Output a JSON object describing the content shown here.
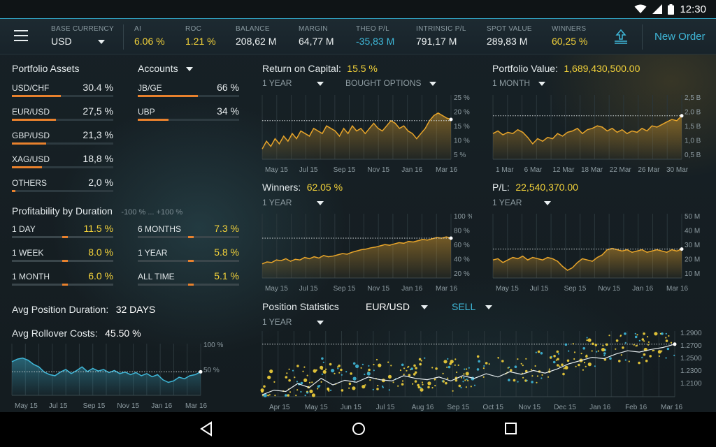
{
  "status": {
    "time": "12:30"
  },
  "header": {
    "base_currency": {
      "label": "BASE CURRENCY",
      "value": "USD"
    },
    "metrics": [
      {
        "label": "AI",
        "value": "6.06 %",
        "tone": "yellow"
      },
      {
        "label": "ROC",
        "value": "1.21 %",
        "tone": "yellow"
      },
      {
        "label": "BALANCE",
        "value": "208,62 M",
        "tone": "white"
      },
      {
        "label": "MARGIN",
        "value": "64,77 M",
        "tone": "white"
      },
      {
        "label": "THEO P/L",
        "value": "-35,83 M",
        "tone": "blue"
      },
      {
        "label": "INTRINSIC P/L",
        "value": "791,17 M",
        "tone": "white"
      },
      {
        "label": "SPOT VALUE",
        "value": "289,83 M",
        "tone": "white"
      },
      {
        "label": "WINNERS",
        "value": "60,25 %",
        "tone": "yellow"
      }
    ],
    "new_order_label": "New Order"
  },
  "portfolio_assets": {
    "title": "Portfolio Assets",
    "items": [
      {
        "name": "USD/CHF",
        "pct": "30.4 %",
        "value": 30.4
      },
      {
        "name": "EUR/USD",
        "pct": "27,5 %",
        "value": 27.5
      },
      {
        "name": "GBP/USD",
        "pct": "21,3 %",
        "value": 21.3
      },
      {
        "name": "XAG/USD",
        "pct": "18,8 %",
        "value": 18.8
      },
      {
        "name": "OTHERS",
        "pct": "2,0 %",
        "value": 2.0
      }
    ]
  },
  "accounts": {
    "title": "Accounts",
    "items": [
      {
        "name": "JB/GE",
        "pct": "66 %",
        "value": 66
      },
      {
        "name": "UBP",
        "pct": "34 %",
        "value": 34
      }
    ]
  },
  "profitability": {
    "title": "Profitability by Duration",
    "range": "-100 % ... +100 %",
    "items": [
      {
        "name": "1 DAY",
        "value": "11.5 %",
        "num": 11.5
      },
      {
        "name": "6 MONTHS",
        "value": "7.3 %",
        "num": 7.3
      },
      {
        "name": "1 WEEK",
        "value": "8.0 %",
        "num": 8.0
      },
      {
        "name": "1 YEAR",
        "value": "5.8 %",
        "num": 5.8
      },
      {
        "name": "1 MONTH",
        "value": "6.0 %",
        "num": 6.0
      },
      {
        "name": "ALL TIME",
        "value": "5.1 %",
        "num": 5.1
      }
    ]
  },
  "avg_position_duration": {
    "label": "Avg Position Duration:",
    "value": "32 DAYS"
  },
  "avg_rollover": {
    "label": "Avg Rollover Costs:",
    "value": "45.50 %"
  },
  "roc_panel": {
    "title": "Return on Capital:",
    "value": "15.5 %",
    "period": "1 YEAR",
    "filter": "BOUGHT OPTIONS"
  },
  "portfolio_value_panel": {
    "title": "Portfolio Value:",
    "value": "1,689,430,500.00",
    "period": "1 MONTH"
  },
  "winners_panel": {
    "title": "Winners:",
    "value": "62.05 %",
    "period": "1 YEAR"
  },
  "pl_panel": {
    "title": "P/L:",
    "value": "22,540,370.00",
    "period": "1 YEAR"
  },
  "position_stats_panel": {
    "title": "Position Statistics",
    "pair": "EUR/USD",
    "side": "SELL",
    "period": "1 YEAR"
  },
  "chart_data": [
    {
      "id": "roc",
      "type": "area",
      "x_labels": [
        "May 15",
        "Jul 15",
        "Sep 15",
        "Nov 15",
        "Jan 16",
        "Mar 16"
      ],
      "y_ticks": [
        "25 %",
        "20 %",
        "15 %",
        "10 %",
        "5 %"
      ],
      "ylim": [
        0,
        25
      ],
      "reference": 15,
      "values": [
        4,
        7,
        5,
        8,
        6,
        9,
        7,
        10,
        8,
        11,
        10,
        9,
        12,
        11,
        10,
        13,
        12,
        11,
        9,
        12,
        10,
        13,
        11,
        12,
        10,
        12,
        14,
        12,
        11,
        13,
        15,
        14,
        12,
        13,
        11,
        10,
        8,
        10,
        12,
        15,
        17,
        18,
        17,
        16,
        15.5
      ]
    },
    {
      "id": "portfolio_value",
      "type": "area",
      "x_labels": [
        "1 Mar",
        "6 Mar",
        "12 Mar",
        "18 Mar",
        "22 Mar",
        "26 Mar",
        "30 Mar"
      ],
      "y_ticks": [
        "2,5 B",
        "2,0 B",
        "1,5 B",
        "1,0 B",
        "0,5 B"
      ],
      "ylim": [
        0,
        2.5
      ],
      "reference": 1.69,
      "values": [
        1.0,
        1.1,
        0.95,
        1.05,
        1.0,
        1.15,
        1.05,
        0.85,
        0.6,
        0.8,
        0.7,
        0.85,
        0.8,
        1.0,
        0.9,
        1.05,
        1.1,
        1.2,
        1.0,
        1.15,
        1.2,
        1.3,
        1.25,
        1.1,
        1.2,
        1.05,
        1.15,
        1.0,
        1.1,
        1.05,
        1.2,
        1.1,
        1.3,
        1.25,
        1.35,
        1.45,
        1.55,
        1.5,
        1.69
      ]
    },
    {
      "id": "winners",
      "type": "area",
      "x_labels": [
        "May 15",
        "Jul 15",
        "Sep 15",
        "Nov 15",
        "Jan 16",
        "Mar 16"
      ],
      "y_ticks": [
        "100 %",
        "80 %",
        "60 %",
        "40 %",
        "20 %"
      ],
      "ylim": [
        0,
        100
      ],
      "reference": 62,
      "values": [
        22,
        25,
        24,
        28,
        27,
        30,
        26,
        29,
        28,
        32,
        30,
        33,
        31,
        35,
        33,
        34,
        36,
        38,
        37,
        40,
        42,
        44,
        45,
        47,
        48,
        50,
        52,
        51,
        53,
        55,
        54,
        57,
        56,
        58,
        60,
        59,
        61,
        63,
        62,
        64,
        62
      ]
    },
    {
      "id": "pl",
      "type": "area",
      "x_labels": [
        "May 15",
        "Jul 15",
        "Sep 15",
        "Nov 15",
        "Jan 16",
        "Mar 16"
      ],
      "y_ticks": [
        "50 M",
        "40 M",
        "30 M",
        "20 M",
        "10 M"
      ],
      "ylim": [
        0,
        50
      ],
      "reference": 22.5,
      "values": [
        14,
        15,
        12,
        14,
        16,
        15,
        17,
        14,
        16,
        15,
        14,
        16,
        15,
        13,
        9,
        6,
        8,
        12,
        15,
        14,
        13,
        16,
        18,
        22,
        23,
        22,
        21,
        22,
        20,
        21,
        22,
        20,
        21,
        22,
        21,
        20,
        22,
        21,
        22.5
      ]
    },
    {
      "id": "rollover",
      "type": "area",
      "x_labels": [
        "May 15",
        "Jul 15",
        "Sep 15",
        "Nov 15",
        "Jan 16",
        "Mar 16"
      ],
      "y_ticks": [
        "100 %",
        "50 %"
      ],
      "ylim": [
        0,
        100
      ],
      "reference": 45.5,
      "values": [
        65,
        70,
        72,
        68,
        60,
        55,
        45,
        40,
        38,
        45,
        50,
        42,
        48,
        55,
        46,
        52,
        47,
        50,
        44,
        48,
        42,
        45,
        40,
        44,
        38,
        42,
        36,
        40,
        30,
        25,
        28,
        35,
        32,
        38,
        40,
        45.5
      ]
    },
    {
      "id": "position_stats",
      "type": "scatter",
      "x_labels": [
        "Apr 15",
        "May 15",
        "Jun 15",
        "Jul 15",
        "Aug 16",
        "Sep 15",
        "Oct 15",
        "Nov 15",
        "Dec 15",
        "Jan 16",
        "Feb 16",
        "Mar 16"
      ],
      "y_ticks": [
        "1.2900",
        "1.2700",
        "1.2500",
        "1.2300",
        "1.2100"
      ],
      "ylim": [
        1.2,
        1.3
      ],
      "reference": 1.28,
      "line": [
        1.203,
        1.21,
        1.208,
        1.22,
        1.214,
        1.228,
        1.218,
        1.225,
        1.222,
        1.23,
        1.226,
        1.224,
        1.232,
        1.228,
        1.226,
        1.23,
        1.224,
        1.232,
        1.228,
        1.235,
        1.23,
        1.238,
        1.234,
        1.24,
        1.236,
        1.242,
        1.25,
        1.255,
        1.26,
        1.258,
        1.265,
        1.27,
        1.268,
        1.272,
        1.275,
        1.28
      ]
    }
  ],
  "nav": {
    "back_icon": "back-triangle-icon",
    "home_icon": "home-circle-icon",
    "recent_icon": "recent-square-icon"
  },
  "colors": {
    "accent": "#f3d23a",
    "blue": "#3fb8d9",
    "orange": "#e8812d",
    "chart_line": "#e8a52a"
  }
}
